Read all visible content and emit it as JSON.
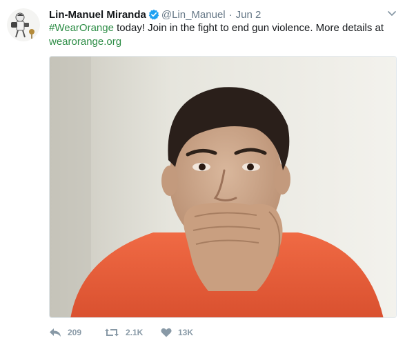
{
  "tweet": {
    "author_name": "Lin-Manuel Miranda",
    "handle": "@Lin_Manuel",
    "separator": "·",
    "date": "Jun 2",
    "hashtag": "#WearOrange",
    "body": " today! Join in the fight to end gun violence. More details at ",
    "link": "wearorange.org",
    "accent_color": "#2d8d46",
    "verified_color": "#1da1f2"
  },
  "actions": {
    "replies": "209",
    "retweets": "2.1K",
    "likes": "13K"
  },
  "icons": {
    "verified": "verified-badge-icon",
    "menu": "chevron-down-icon",
    "reply": "reply-icon",
    "retweet": "retweet-icon",
    "like": "heart-icon"
  }
}
